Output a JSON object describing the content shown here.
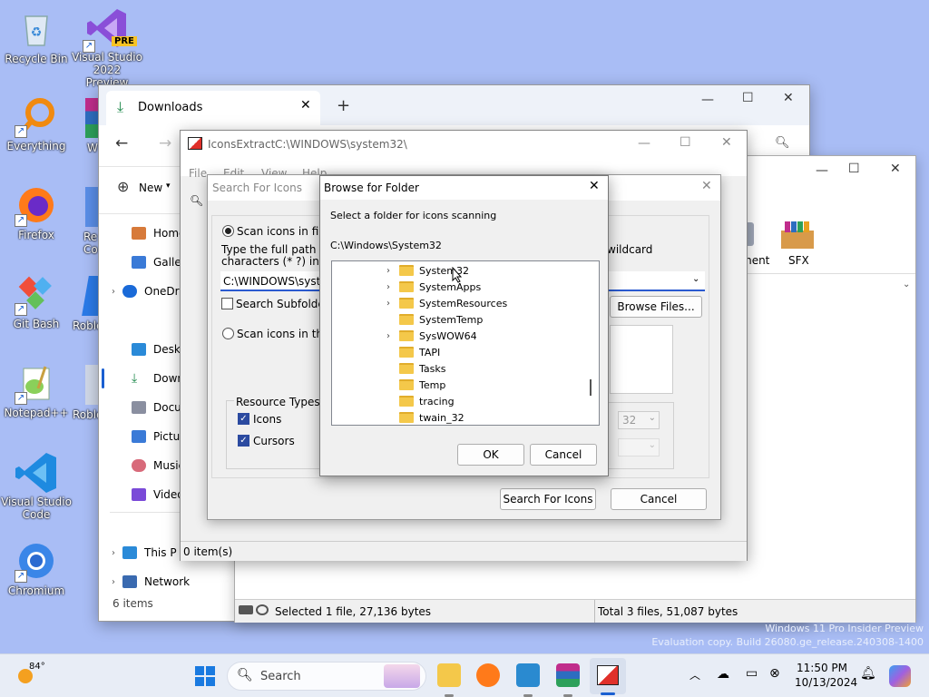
{
  "desktop": {
    "icons": [
      {
        "label": "Recycle Bin"
      },
      {
        "label": "Visual Studio 2022 Preview",
        "badge": "PRE"
      },
      {
        "label": "Everything"
      },
      {
        "label": "W"
      },
      {
        "label": "Firefox"
      },
      {
        "label": "Re Co"
      },
      {
        "label": "Git Bash"
      },
      {
        "label": "Roblo"
      },
      {
        "label": "Notepad++"
      },
      {
        "label": "Roblo"
      },
      {
        "label": "Visual Studio Code"
      },
      {
        "label": "Chromium"
      }
    ],
    "watermark_line1": "Windows 11 Pro Insider Preview",
    "watermark_line2": "Evaluation copy. Build 26080.ge_release.240308-1400"
  },
  "explorer": {
    "tab_title": "Downloads",
    "new_tab": "+",
    "new_label": "New",
    "sidebar": [
      {
        "label": "Home"
      },
      {
        "label": "Gallery"
      },
      {
        "label": "OneDr"
      },
      {
        "label": "Deskto"
      },
      {
        "label": "Downl"
      },
      {
        "label": "Docum"
      },
      {
        "label": "Picture"
      },
      {
        "label": "Music"
      },
      {
        "label": "Videos"
      },
      {
        "label": "This P"
      },
      {
        "label": "Network"
      }
    ],
    "items_count": "6 items"
  },
  "win2": {
    "item_label_1": "ment",
    "item_label_2": "SFX",
    "status_selected": "Selected 1 file, 27,136 bytes",
    "status_total": "Total 3 files, 51,087 bytes"
  },
  "iconsextract": {
    "title_app": "IconsExtract",
    "title_path": "C:\\WINDOWS\\system32\\",
    "menu": [
      "File",
      "Edit",
      "View",
      "Help"
    ],
    "status": "0 item(s)"
  },
  "search": {
    "title": "Search For Icons",
    "radio1": "Scan icons in files",
    "instructions_1": "Type the full path of the",
    "instructions_2": "characters (* ?) in order",
    "wildcard": "wildcard",
    "path_value": "C:\\WINDOWS\\system",
    "subfolders": "Search Subfolders",
    "browse_files": "Browse Files...",
    "radio2": "Scan icons in the se",
    "resource_types": "Resource Types",
    "icons": "Icons",
    "cursors": "Cursors",
    "size_value": "32",
    "search_btn": "Search For Icons",
    "cancel_btn": "Cancel"
  },
  "browse": {
    "title": "Browse for Folder",
    "prompt": "Select a folder for icons scanning",
    "path": "C:\\Windows\\System32",
    "folders": [
      {
        "name": "System32",
        "expand": true
      },
      {
        "name": "SystemApps",
        "expand": true
      },
      {
        "name": "SystemResources",
        "expand": true
      },
      {
        "name": "SystemTemp",
        "expand": false
      },
      {
        "name": "SysWOW64",
        "expand": true
      },
      {
        "name": "TAPI",
        "expand": false
      },
      {
        "name": "Tasks",
        "expand": false
      },
      {
        "name": "Temp",
        "expand": false
      },
      {
        "name": "tracing",
        "expand": false
      },
      {
        "name": "twain_32",
        "expand": false
      }
    ],
    "ok": "OK",
    "cancel": "Cancel"
  },
  "taskbar": {
    "weather": "84°",
    "search_placeholder": "Search",
    "time": "11:50 PM",
    "date": "10/13/2024"
  }
}
